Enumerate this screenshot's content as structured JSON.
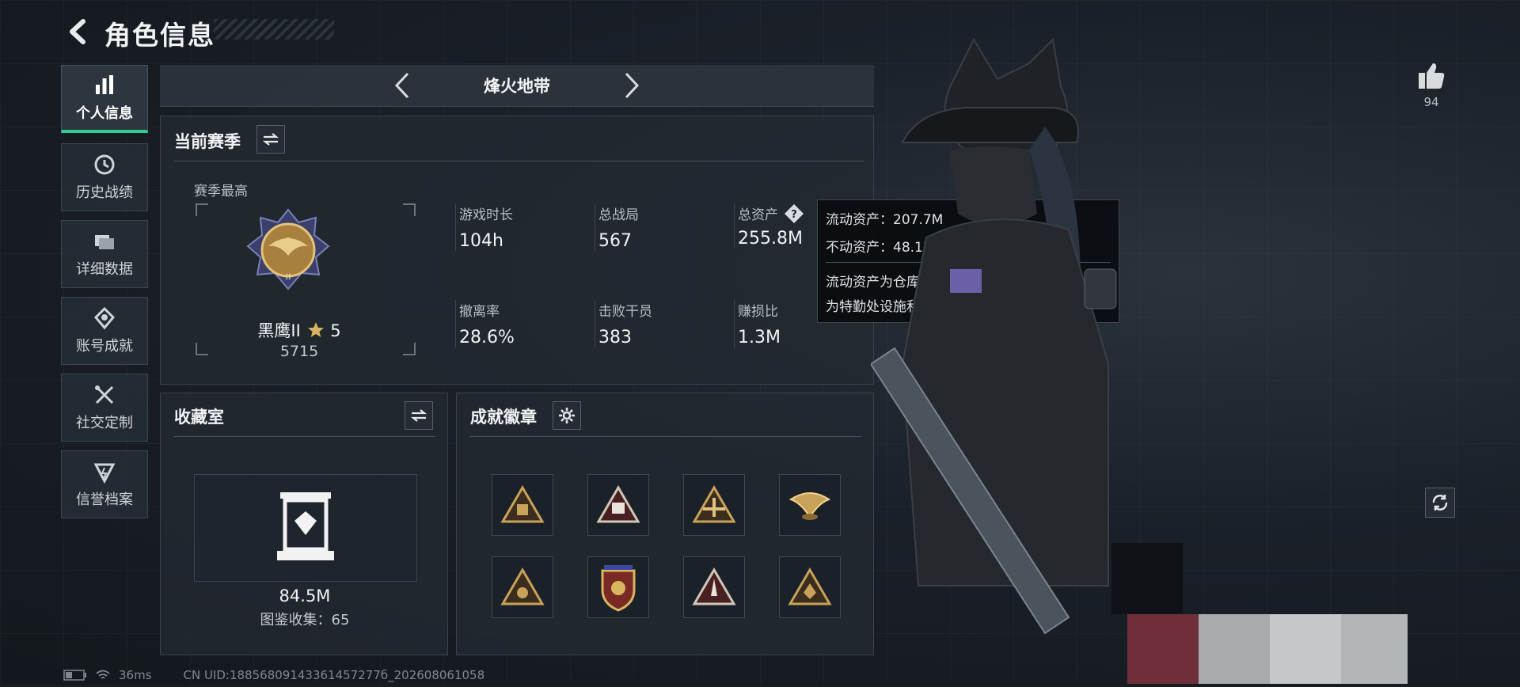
{
  "header": {
    "title": "角色信息"
  },
  "sidebar": {
    "items": [
      {
        "label": "个人信息",
        "icon": "bar-chart-icon",
        "active": true
      },
      {
        "label": "历史战绩",
        "icon": "history-icon"
      },
      {
        "label": "详细数据",
        "icon": "folder-icon"
      },
      {
        "label": "账号成就",
        "icon": "achievement-icon"
      },
      {
        "label": "社交定制",
        "icon": "tools-icon"
      },
      {
        "label": "信誉档案",
        "icon": "credit-icon"
      }
    ]
  },
  "mode": {
    "name": "烽火地带"
  },
  "season": {
    "title": "当前赛季",
    "best_label": "赛季最高",
    "rank_name": "黑鹰II",
    "rank_stars": "5",
    "rank_points": "5715",
    "stats": [
      {
        "label": "游戏时长",
        "value": "104h"
      },
      {
        "label": "总战局",
        "value": "567"
      },
      {
        "label": "总资产",
        "value": "255.8M"
      },
      {
        "label": "撤离率",
        "value": "28.6%"
      },
      {
        "label": "击败干员",
        "value": "383"
      },
      {
        "label": "赚损比",
        "value": "1.3M"
      }
    ]
  },
  "tooltip": {
    "liquid": "流动资产：207.7M",
    "fixed": "不动资产：48.1M",
    "desc_line1": "流动资产为仓库资产和哈夫币，不动资产",
    "desc_line2": "为特勤处设施和收藏室设施"
  },
  "collection": {
    "title": "收藏室",
    "value": "84.5M",
    "catalog": "图鉴收集：65"
  },
  "achievements": {
    "title": "成就徽章"
  },
  "likes": {
    "count": "94"
  },
  "status_bar": {
    "ping": "36ms",
    "uid": "CN UID:18856809143361457277б_202608061058"
  },
  "colors": {
    "accent": "#2ecf8f",
    "gold": "#c9a25a",
    "bg": "#161c22"
  }
}
